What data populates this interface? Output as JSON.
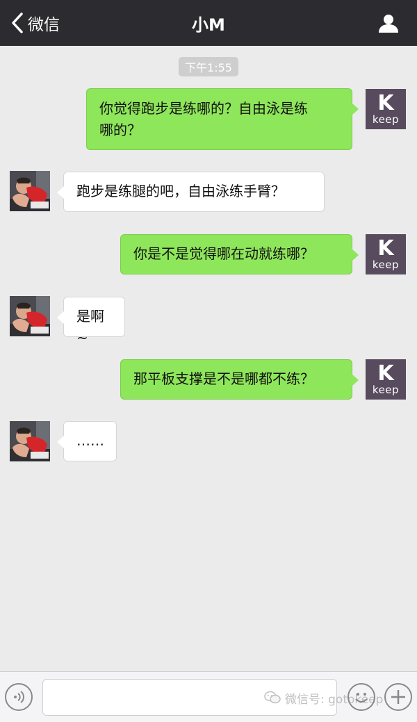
{
  "navbar": {
    "back_label": "微信",
    "title": "小M"
  },
  "chat": {
    "timestamp": "下午1:55",
    "keep_avatar_letter": "K",
    "keep_avatar_word": "keep",
    "messages": [
      {
        "side": "sent",
        "line1": "你觉得跑步是练哪的？自由泳是练",
        "line2": "哪的？"
      },
      {
        "side": "received",
        "text": "跑步是练腿的吧，自由泳练手臂？"
      },
      {
        "side": "sent",
        "text": "你是不是觉得哪在动就练哪？"
      },
      {
        "side": "received",
        "text": "是啊~"
      },
      {
        "side": "sent",
        "text": "那平板支撑是不是哪都不练？"
      },
      {
        "side": "received",
        "text": "……"
      }
    ]
  },
  "inputbar": {
    "watermark": "微信号: gotokeep"
  },
  "colors": {
    "navbar_bg": "#2c2c30",
    "sent_bubble": "#8ee65a",
    "received_bubble": "#ffffff",
    "chat_bg": "#ebebeb",
    "keep_avatar_bg": "#584b5e"
  }
}
